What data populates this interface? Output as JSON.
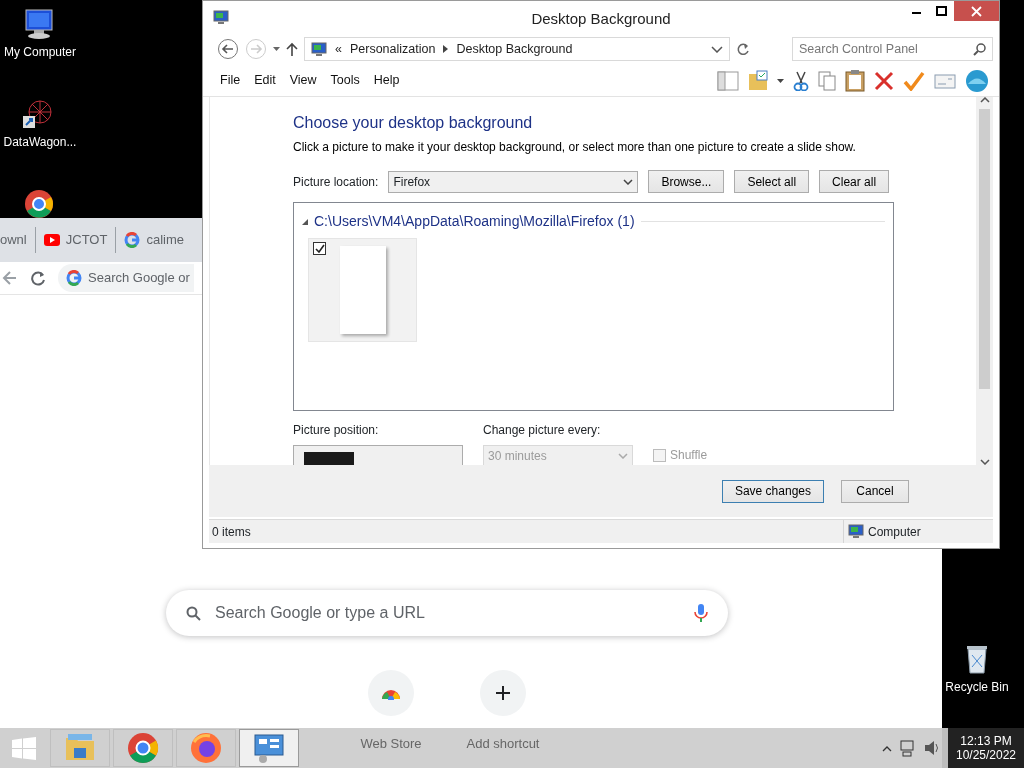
{
  "desktop_icons": [
    {
      "kind": "computer",
      "label": "My Computer"
    },
    {
      "kind": "datawagon",
      "label": "DataWagon..."
    },
    {
      "kind": "recycle",
      "label": "Recycle Bin"
    }
  ],
  "browser": {
    "tabs": [
      {
        "kind": "page",
        "label": "ownl",
        "selected": false
      },
      {
        "kind": "youtube",
        "label": "JCTOT",
        "selected": false
      },
      {
        "kind": "google",
        "label": "calime",
        "selected": false
      }
    ],
    "omnibox": {
      "placeholder": "Search Google or"
    },
    "search": {
      "placeholder": "Search Google or type a URL"
    },
    "shortcuts": [
      {
        "kind": "store",
        "label": "Web Store"
      },
      {
        "kind": "add",
        "label": "Add shortcut"
      }
    ]
  },
  "dialog": {
    "title": "Desktop Background",
    "breadcrumb": {
      "overflow": "«",
      "items": [
        "Personalization",
        "Desktop Background"
      ]
    },
    "search": {
      "placeholder": "Search Control Panel"
    },
    "menu": [
      "File",
      "Edit",
      "View",
      "Tools",
      "Help"
    ],
    "heading": "Choose your desktop background",
    "description": "Click a picture to make it your desktop background, or select more than one picture to create a slide show.",
    "location": {
      "label": "Picture location:",
      "value": "Firefox"
    },
    "buttons": [
      "Browse...",
      "Select all",
      "Clear all"
    ],
    "gallery": {
      "group": "C:\\Users\\VM4\\AppData\\Roaming\\Mozilla\\Firefox (1)",
      "pictures": [
        {
          "checked": true
        }
      ]
    },
    "position": {
      "label": "Picture position:"
    },
    "interval": {
      "label": "Change picture every:",
      "value": "30 minutes",
      "disabled": true
    },
    "shuffle": {
      "label": "Shuffle",
      "checked": false,
      "disabled": true
    },
    "actions": [
      {
        "label": "Save changes",
        "default": true
      },
      {
        "label": "Cancel",
        "default": false
      }
    ],
    "status": {
      "items": "0 items",
      "zone": "Computer"
    }
  },
  "taskbar": {
    "apps": [
      {
        "kind": "explorer",
        "active": false
      },
      {
        "kind": "chrome",
        "active": false
      },
      {
        "kind": "firefox",
        "active": false
      },
      {
        "kind": "control-panel",
        "active": true
      }
    ],
    "clock": {
      "time": "12:13 PM",
      "date": "10/25/2022"
    }
  }
}
